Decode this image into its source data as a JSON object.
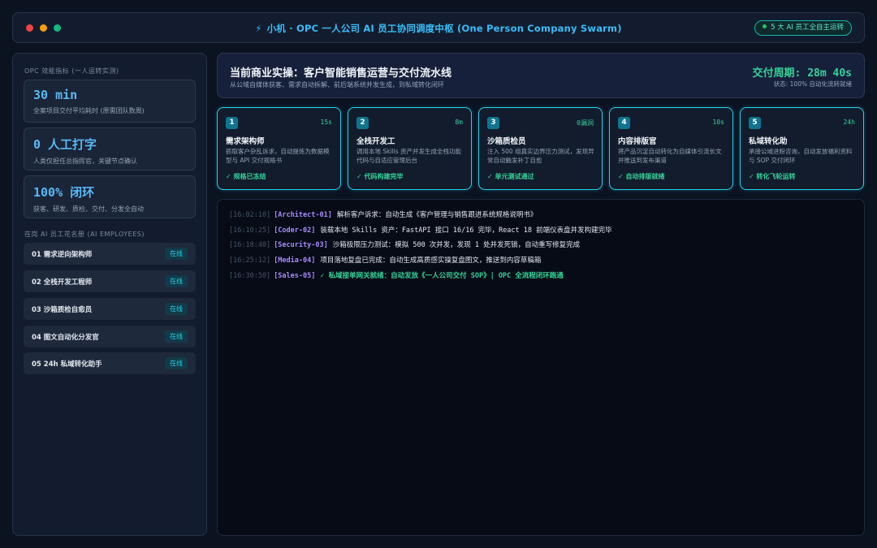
{
  "titlebar": {
    "title": "小机 · OPC 一人公司 AI 员工协同调度中枢 (One Person Company Swarm)",
    "run_badge": "5 大 AI 员工全自主运转",
    "colors": {
      "close": "#ef4444",
      "minimize": "#f59e0b",
      "maximize": "#10b981",
      "accent": "#38bdf8"
    }
  },
  "sidebar": {
    "metrics_heading": "OPC 效能指标 (一人运转实测)",
    "metrics": [
      {
        "value": "30 min",
        "label": "全案项目交付平均耗时 (原需团队数周)"
      },
      {
        "value": "0 人工打字",
        "label": "人类仅担任总指挥官，关键节点确认"
      },
      {
        "value": "100% 闭环",
        "label": "获客、研发、质检、交付、分发全自动"
      }
    ],
    "employees_heading": "在岗 AI 员工花名册 (AI EMPLOYEES)",
    "employees": [
      {
        "name": "01 需求逆向架构师",
        "status": "在线"
      },
      {
        "name": "02 全栈开发工程师",
        "status": "在线"
      },
      {
        "name": "03 沙箱质检自愈员",
        "status": "在线"
      },
      {
        "name": "04 图文自动化分发官",
        "status": "在线"
      },
      {
        "name": "05 24h 私域转化助手",
        "status": "在线"
      }
    ]
  },
  "header": {
    "title": "当前商业实操：客户智能销售运营与交付流水线",
    "subtitle": "从公域自媒体获客、需求自动拆解、前后端系统并发生成，到私域转化闭环",
    "cycle": "交付周期: 28m 40s",
    "state": "状态: 100% 自动化流转就绪"
  },
  "pipeline": [
    {
      "num": "1",
      "time": "15s",
      "name": "需求架构师",
      "desc": "抓取客户杂乱诉求，自动提炼为数据模型与 API 交付规格书",
      "status": "✓ 规格已冻结"
    },
    {
      "num": "2",
      "time": "8m",
      "name": "全栈开发工",
      "desc": "调用本地 Skills 资产并发生成全栈功能代码与自适应管理后台",
      "status": "✓ 代码构建完毕"
    },
    {
      "num": "3",
      "time": "0漏洞",
      "name": "沙箱质检员",
      "desc": "注入 500 组真实边界压力测试，发现异常自动触发补丁自愈",
      "status": "✓ 单元测试通过"
    },
    {
      "num": "4",
      "time": "10s",
      "name": "内容排版官",
      "desc": "将产品沉淀自动转化为自媒体引流长文并推送到发布渠道",
      "status": "✓ 自动排版就绪"
    },
    {
      "num": "5",
      "time": "24h",
      "name": "私域转化助",
      "desc": "承接公域进粉咨询，自动发放福利资料与 SOP 交付闭环",
      "status": "✓ 转化飞轮运转"
    }
  ],
  "logs": [
    {
      "time": "[16:02:10]",
      "agent": "[Architect-01]",
      "msg": "解析客户诉求：自动生成《客户管理与销售跟进系统规格说明书》",
      "ok": false
    },
    {
      "time": "[16:10:25]",
      "agent": "[Coder-02]",
      "msg": "装载本地 Skills 资产：FastAPI 接口 16/16 完毕，React 18 前端仪表盘并发构建完毕",
      "ok": false
    },
    {
      "time": "[16:18:40]",
      "agent": "[Security-03]",
      "msg": "沙箱极限压力测试：模拟 500 次并发，发现 1 处并发死锁，自动重写修复完成",
      "ok": false
    },
    {
      "time": "[16:25:12]",
      "agent": "[Media-04]",
      "msg": "项目落地复盘已完成：自动生成高质感实操复盘图文，推送到内容草稿箱",
      "ok": false
    },
    {
      "time": "[16:30:50]",
      "agent": "[Sales-05]",
      "msg": "✓ 私域接单网关就绪：自动发放《一人公司交付 SOP》| OPC 全流程闭环跑通",
      "ok": true
    }
  ]
}
